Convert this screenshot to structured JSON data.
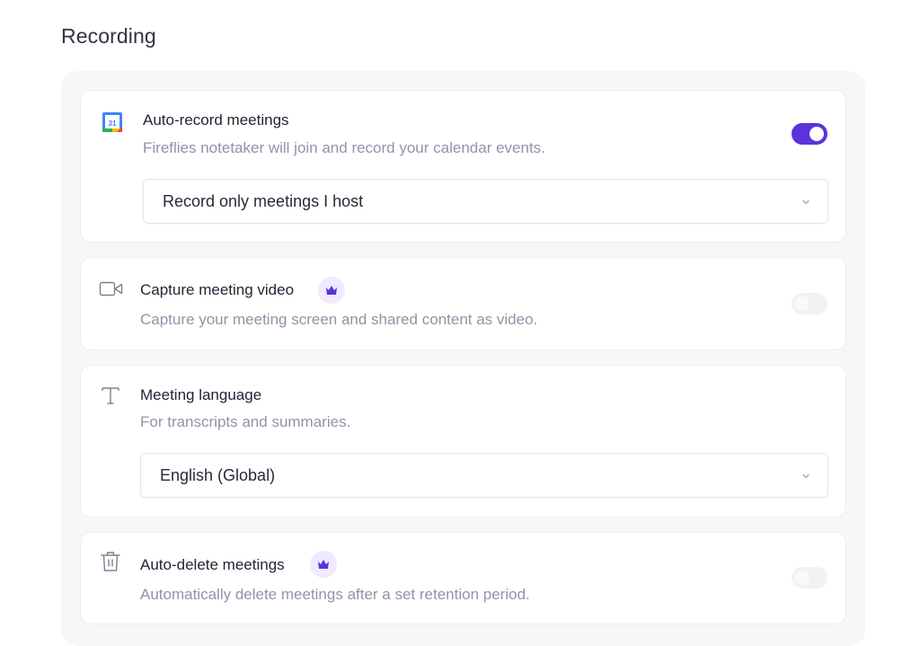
{
  "section": {
    "title": "Recording"
  },
  "auto_record": {
    "title": "Auto-record meetings",
    "description": "Fireflies notetaker will join and record your calendar events.",
    "enabled": true,
    "calendar_day": "31",
    "select_value": "Record only meetings I host"
  },
  "capture_video": {
    "title": "Capture meeting video",
    "description": "Capture your meeting screen and shared content as video.",
    "enabled": false,
    "premium_icon": "crown-icon"
  },
  "meeting_language": {
    "title": "Meeting language",
    "description": "For transcripts and summaries.",
    "select_value": "English (Global)"
  },
  "auto_delete": {
    "title": "Auto-delete meetings",
    "description": "Automatically delete meetings after a set retention period.",
    "enabled": false,
    "premium_icon": "crown-icon"
  },
  "colors": {
    "accent": "#5a33db",
    "badge_bg": "#eeeaff",
    "muted_text": "#8f95a6"
  }
}
